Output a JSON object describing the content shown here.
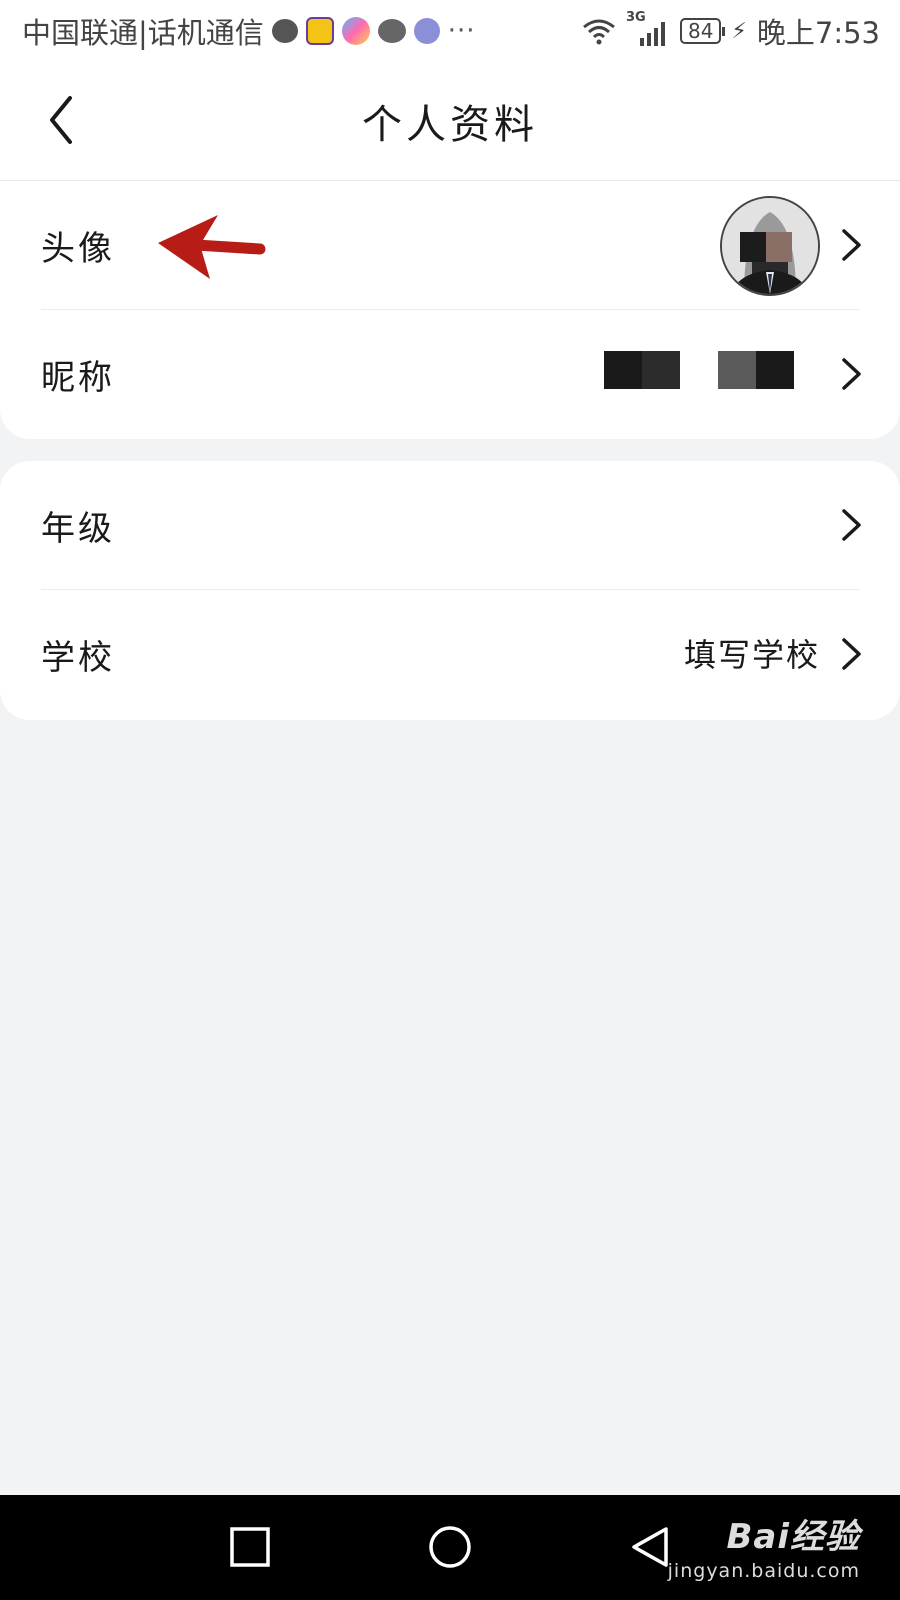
{
  "status_bar": {
    "carrier": "中国联通|话机通信",
    "notification_icons": [
      "message-icon",
      "book-app-icon",
      "ball-app-icon",
      "wechat-icon",
      "astronaut-app-icon"
    ],
    "more": "···",
    "network": "3G",
    "battery": "84",
    "time": "晚上7:53"
  },
  "header": {
    "title": "个人资料"
  },
  "profile_card": {
    "rows": [
      {
        "label": "头像",
        "value": ""
      },
      {
        "label": "昵称",
        "value": ""
      }
    ]
  },
  "info_card": {
    "rows": [
      {
        "label": "年级",
        "value": ""
      },
      {
        "label": "学校",
        "value": "填写学校"
      }
    ]
  },
  "watermark": {
    "brand": "Bai经验",
    "url": "jingyan.baidu.com"
  },
  "colors": {
    "annotation_arrow": "#b81c16",
    "background": "#f2f3f5",
    "card": "#ffffff"
  }
}
